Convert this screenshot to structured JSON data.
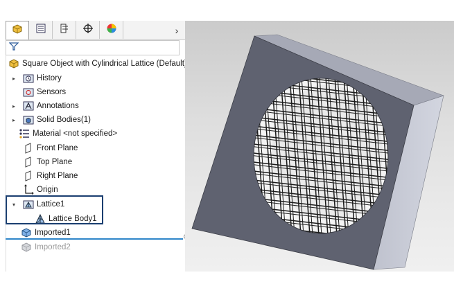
{
  "feature_manager": {
    "tabs": [
      {
        "icon": "part-icon",
        "active": true
      },
      {
        "icon": "property-manager-icon",
        "active": false
      },
      {
        "icon": "configuration-manager-icon",
        "active": false
      },
      {
        "icon": "dimxpert-icon",
        "active": false
      },
      {
        "icon": "display-manager-icon",
        "active": false
      }
    ],
    "more_glyph": "›",
    "filter_icon": "filter-icon",
    "root": {
      "label": "Square Object with Cylindrical Lattice  (Default)",
      "icon": "part-icon"
    },
    "items": [
      {
        "label": "History",
        "icon": "history-folder-icon",
        "expander": "▸"
      },
      {
        "label": "Sensors",
        "icon": "sensors-icon",
        "expander": ""
      },
      {
        "label": "Annotations",
        "icon": "annotations-icon",
        "expander": "▸"
      },
      {
        "label": "Solid Bodies(1)",
        "icon": "solid-bodies-folder-icon",
        "expander": "▸"
      },
      {
        "label": "Material <not specified>",
        "icon": "material-icon",
        "expander": ""
      },
      {
        "label": "Front Plane",
        "icon": "plane-icon",
        "expander": ""
      },
      {
        "label": "Top Plane",
        "icon": "plane-icon",
        "expander": ""
      },
      {
        "label": "Right Plane",
        "icon": "plane-icon",
        "expander": ""
      },
      {
        "label": "Origin",
        "icon": "origin-icon",
        "expander": ""
      },
      {
        "label": "Lattice1",
        "icon": "lattice-feature-icon",
        "expander": "▾"
      },
      {
        "label": "Lattice Body1",
        "icon": "lattice-body-icon",
        "expander": ""
      },
      {
        "label": "Imported1",
        "icon": "imported-body-icon",
        "expander": ""
      },
      {
        "label": "Imported2",
        "icon": "imported-body-icon",
        "expander": "",
        "suppressed": true
      }
    ]
  },
  "viewport": {
    "model": "square-block-with-cylindrical-lattice",
    "colors": {
      "block_face": "#5f6270",
      "block_side": "#c7cad6",
      "block_top": "#a6a9b6",
      "lattice": "#1b1b1b",
      "bore": "#f4f4f4"
    }
  },
  "colors": {
    "highlight": "#1a3e70",
    "rollback_bar": "#2f86c9"
  }
}
